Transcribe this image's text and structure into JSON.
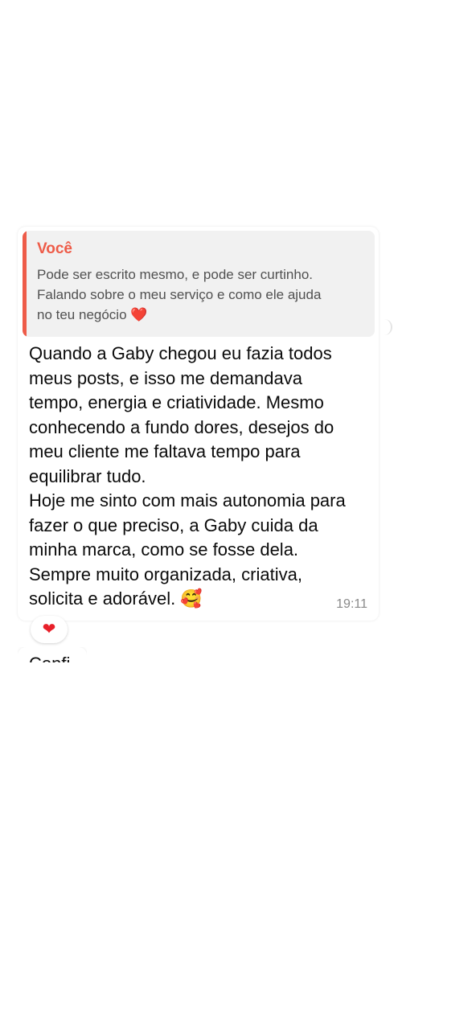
{
  "message": {
    "reply_to": {
      "author": "Você",
      "text": "Pode ser escrito mesmo, e pode ser curtinho.\nFalando sobre o meu serviço e como ele ajuda\nno teu negócio ❤️"
    },
    "text": "Quando a Gaby chegou eu fazia todos\nmeus posts, e isso me demandava\ntempo, energia e criatividade. Mesmo\nconhecendo a fundo dores, desejos do\nmeu cliente me faltava tempo para\nequilibrar tudo.\nHoje me sinto com mais autonomia para\nfazer o que preciso, a Gaby cuida da\nminha marca, como se fosse dela.\nSempre muito organizada, criativa,\nsolicita e adorável. 🥰",
    "time": "19:11",
    "reaction": "❤"
  },
  "next_message": {
    "partial_text": "Confi"
  },
  "colors": {
    "accent": "#ee5b48",
    "quote_background": "#f1f1f1",
    "heart": "#e8202a"
  }
}
